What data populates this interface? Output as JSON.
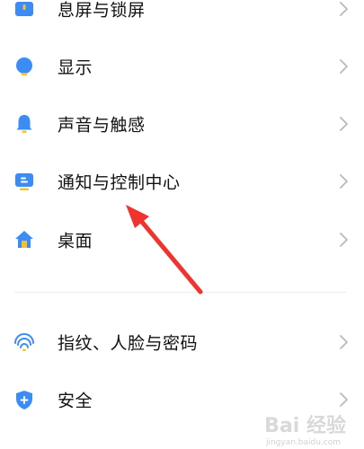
{
  "settings": {
    "items": [
      {
        "label": "息屏与锁屏",
        "icon": "lock-screen-icon"
      },
      {
        "label": "显示",
        "icon": "display-icon"
      },
      {
        "label": "声音与触感",
        "icon": "bell-icon"
      },
      {
        "label": "通知与控制中心",
        "icon": "notification-icon"
      },
      {
        "label": "桌面",
        "icon": "home-icon"
      },
      {
        "label": "指纹、人脸与密码",
        "icon": "fingerprint-icon"
      },
      {
        "label": "安全",
        "icon": "shield-icon"
      }
    ]
  },
  "annotation": {
    "arrow_color": "#f0332c"
  },
  "watermark": {
    "text": "Bai 经验",
    "sub": "jingyan.baidu.com"
  },
  "colors": {
    "icon_blue": "#3b8cf5",
    "icon_yellow": "#f8c12c",
    "chevron": "#b9b9b9"
  }
}
